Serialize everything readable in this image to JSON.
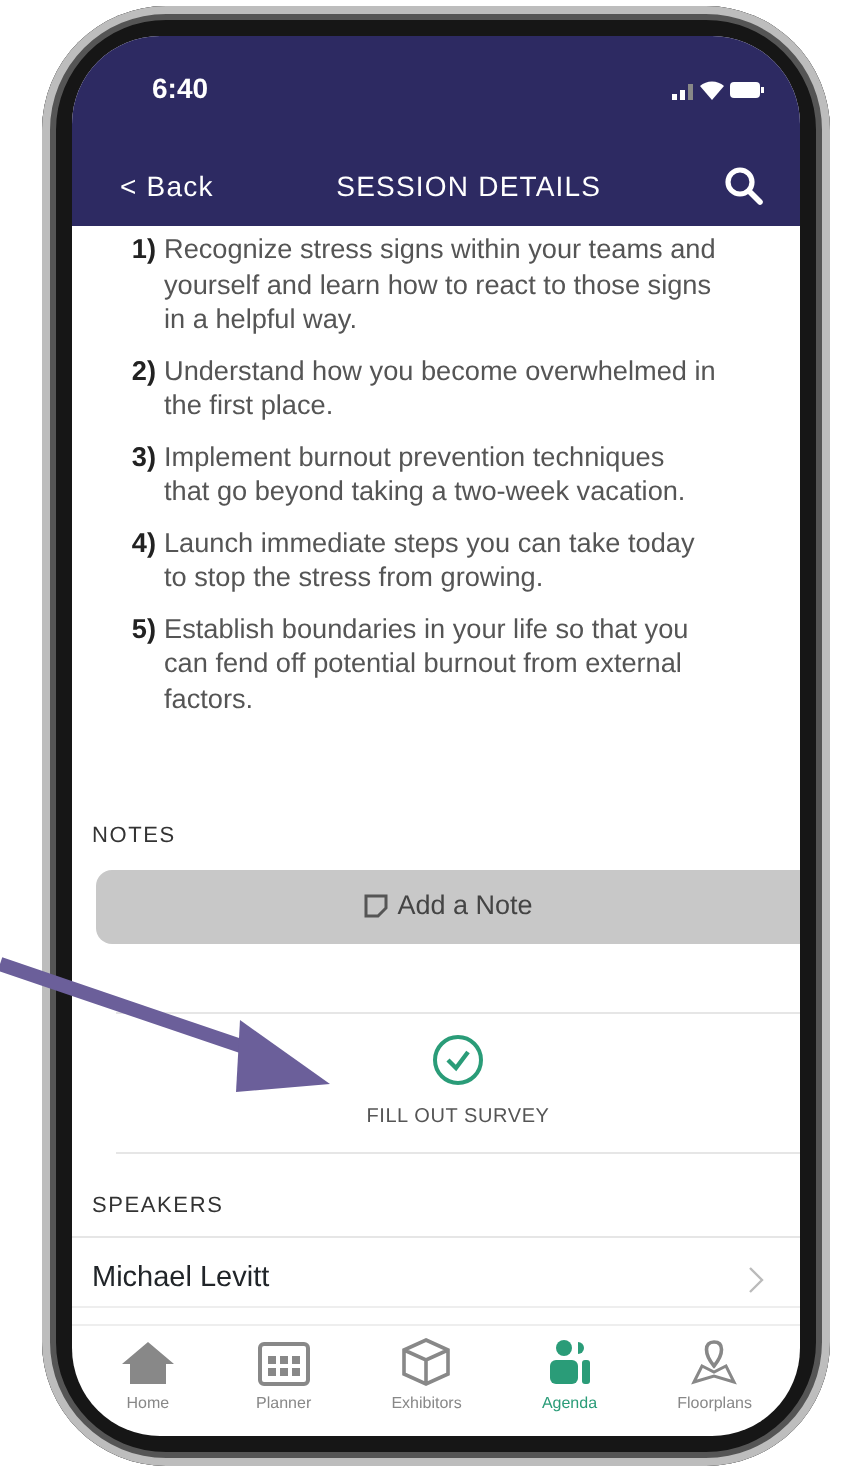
{
  "status_bar": {
    "time": "6:40"
  },
  "nav": {
    "back": "< Back",
    "title": "SESSION DETAILS"
  },
  "objectives": [
    {
      "number": "1)",
      "text": "Recognize stress signs within your teams and yourself and learn how to react to those signs in a helpful way."
    },
    {
      "number": "2)",
      "text": "Understand how you become overwhelmed in the first place."
    },
    {
      "number": "3)",
      "text": "Implement burnout prevention techniques that go beyond taking a two-week vacation."
    },
    {
      "number": "4)",
      "text": "Launch immediate steps you can take today to stop the stress from growing."
    },
    {
      "number": "5)",
      "text": "Establish boundaries in your life so that you can fend off potential burnout from external factors."
    }
  ],
  "notes": {
    "heading": "NOTES",
    "button": "Add a Note"
  },
  "survey": {
    "label": "FILL OUT SURVEY"
  },
  "speakers": {
    "heading": "SPEAKERS",
    "items": [
      {
        "name": "Michael Levitt"
      }
    ]
  },
  "tab_bar": [
    {
      "kind": "home",
      "label": "Home",
      "selected": false
    },
    {
      "kind": "planner",
      "label": "Planner",
      "selected": false
    },
    {
      "kind": "exhibitors",
      "label": "Exhibitors",
      "selected": false
    },
    {
      "kind": "agenda",
      "label": "Agenda",
      "selected": true
    },
    {
      "kind": "floorplans",
      "label": "Floorplans",
      "selected": false
    }
  ]
}
